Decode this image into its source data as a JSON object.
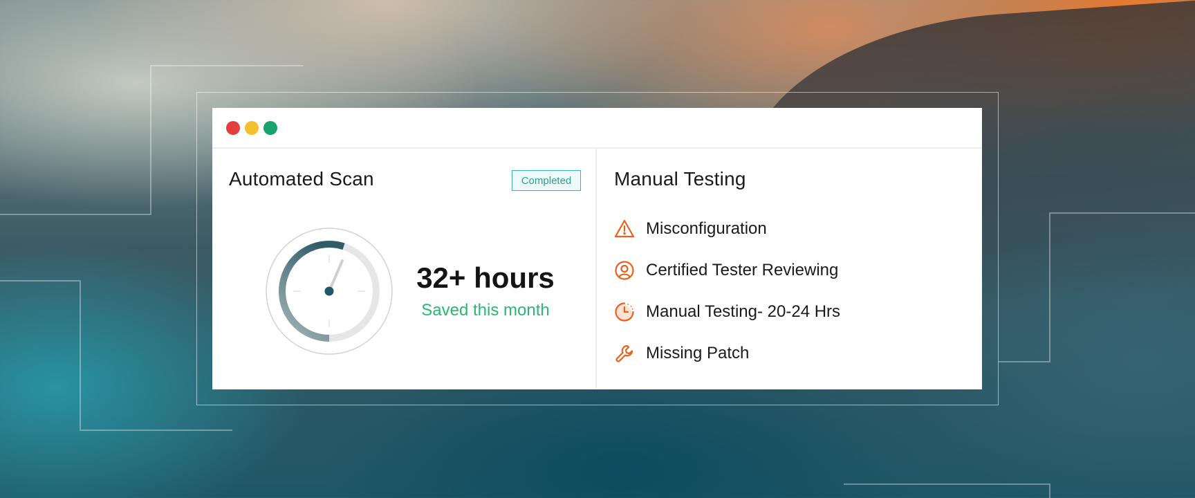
{
  "window": {
    "controls": [
      "close",
      "minimize",
      "maximize"
    ]
  },
  "automated_scan": {
    "title": "Automated Scan",
    "status_badge": "Completed",
    "gauge_progress": 0.55,
    "stat_value": "32+ hours",
    "stat_caption": "Saved this month"
  },
  "manual_testing": {
    "title": "Manual Testing",
    "items": [
      {
        "icon": "warning-triangle-icon",
        "label": "Misconfiguration"
      },
      {
        "icon": "user-circle-icon",
        "label": "Certified Tester Reviewing"
      },
      {
        "icon": "clock-pie-icon",
        "label": "Manual Testing- 20-24 Hrs"
      },
      {
        "icon": "wrench-icon",
        "label": "Missing Patch"
      }
    ]
  },
  "colors": {
    "accent_orange": "#e8601c",
    "badge_teal": "#36b3ad",
    "caption_green": "#2bb673",
    "gauge_dark": "#2f5d66"
  }
}
